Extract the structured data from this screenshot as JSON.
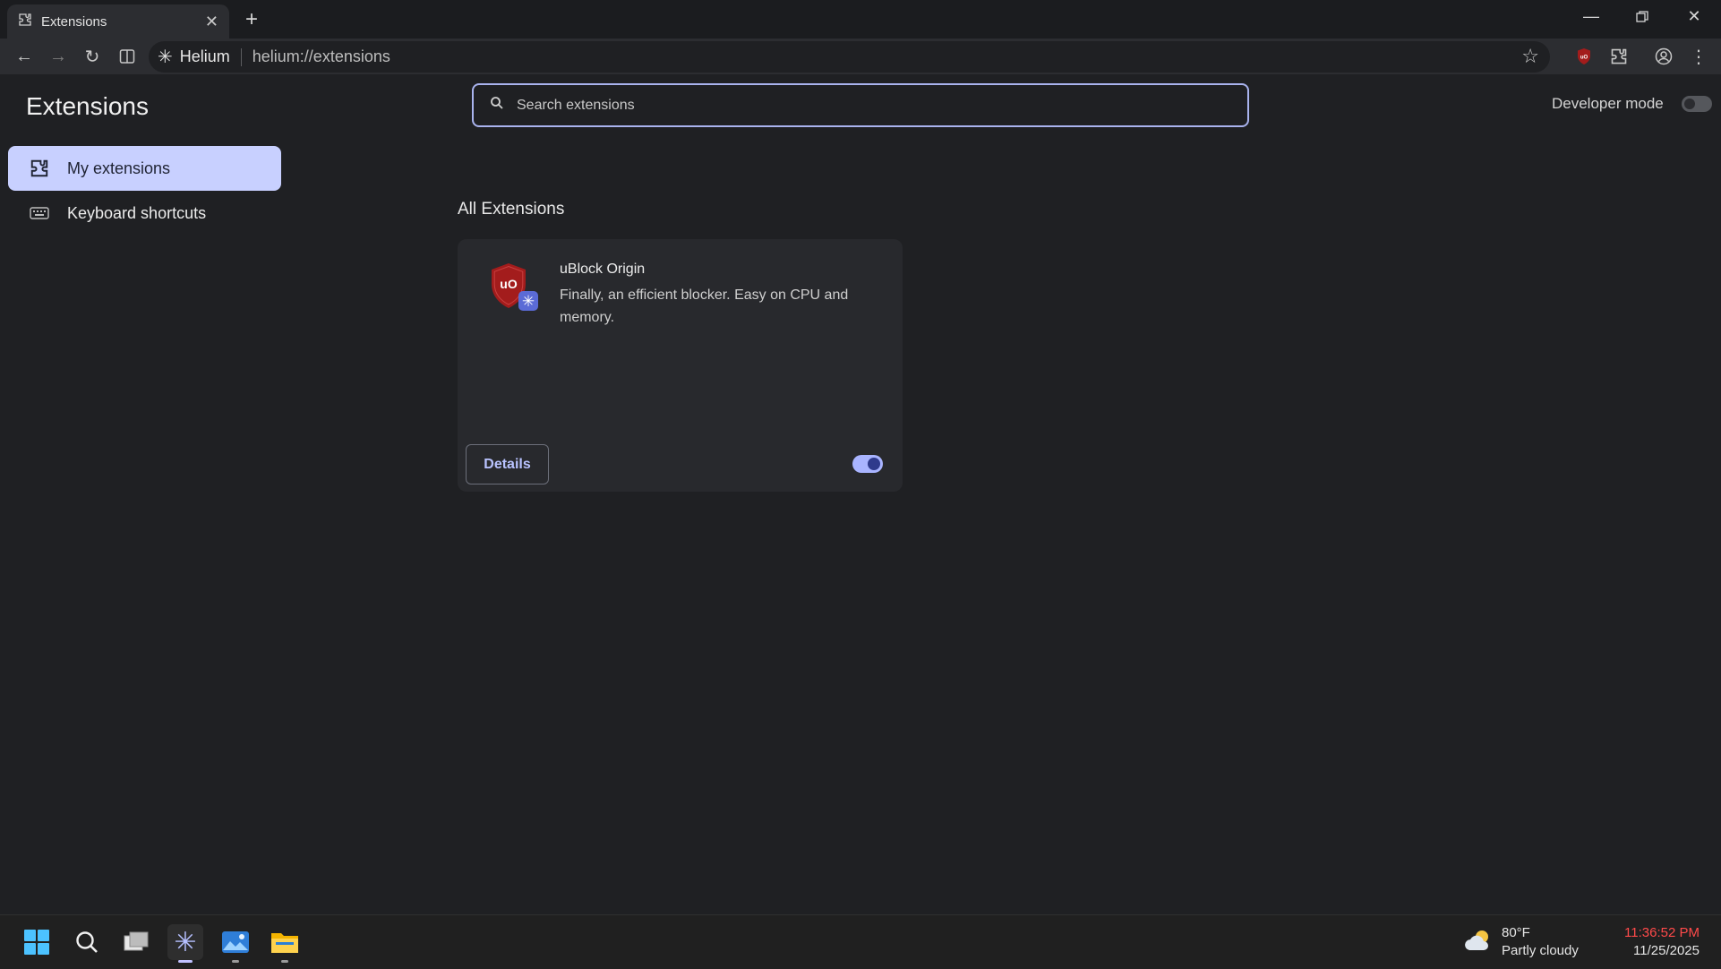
{
  "browser": {
    "tab_title": "Extensions",
    "site_name": "Helium",
    "url": "helium://extensions"
  },
  "page": {
    "title": "Extensions",
    "nav": [
      {
        "label": "My extensions",
        "active": true
      },
      {
        "label": "Keyboard shortcuts",
        "active": false
      }
    ],
    "search_placeholder": "Search extensions",
    "developer_mode_label": "Developer mode",
    "developer_mode_enabled": false,
    "section_title": "All Extensions",
    "extensions": [
      {
        "name": "uBlock Origin",
        "description": "Finally, an efficient blocker. Easy on CPU and memory.",
        "details_label": "Details",
        "enabled": true
      }
    ]
  },
  "taskbar": {
    "weather_temp": "80°F",
    "weather_desc": "Partly cloudy",
    "time": "11:36:52 PM",
    "date": "11/25/2025"
  },
  "colors": {
    "accent": "#c8d0ff",
    "toggle_on": "#a9b4ff",
    "ublock_red": "#a31c1c"
  }
}
